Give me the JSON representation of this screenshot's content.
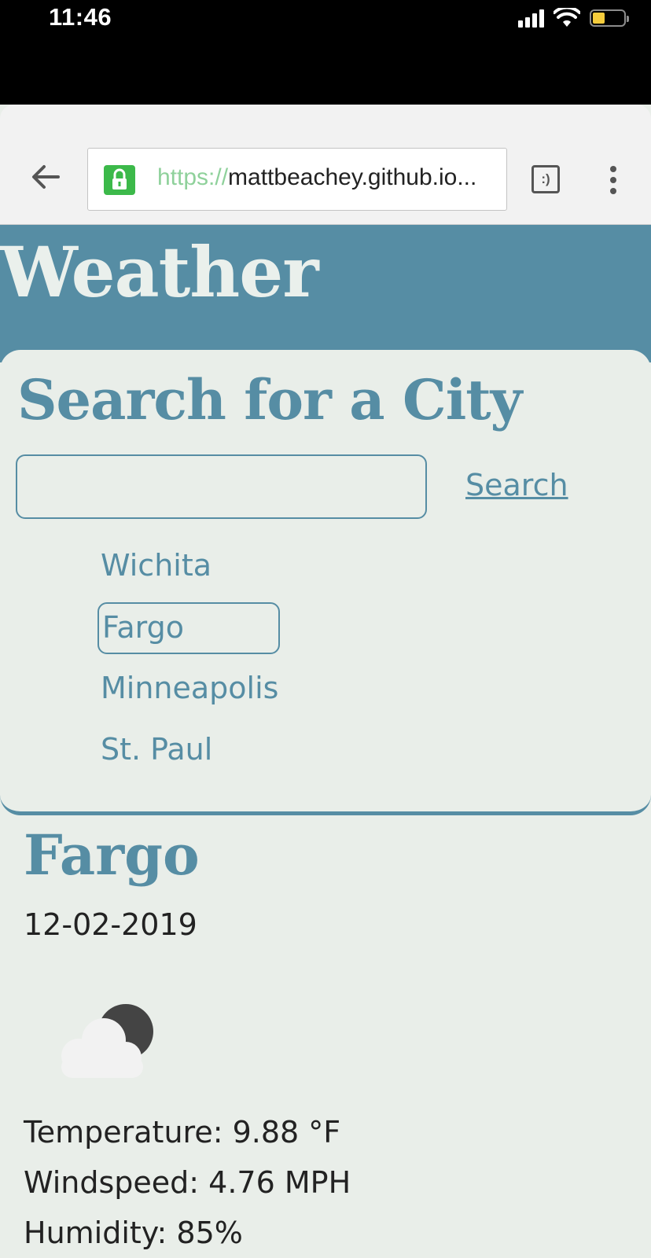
{
  "status_bar": {
    "time": "11:46",
    "battery_color": "#f5cc3c"
  },
  "browser": {
    "url_scheme": "https://",
    "url_host": "mattbeachey.github.io...",
    "tabs_label": ":)"
  },
  "page": {
    "header_title": "Weather",
    "search": {
      "title": "Search for a City",
      "input_value": "",
      "input_placeholder": "",
      "button_label": "Search"
    },
    "cities": [
      {
        "label": "Wichita"
      },
      {
        "label": "Fargo"
      },
      {
        "label": "Minneapolis"
      },
      {
        "label": "St. Paul"
      }
    ],
    "selected_city": "Fargo",
    "result": {
      "city": "Fargo",
      "date": "12-02-2019",
      "icon": "partly-cloudy-night-icon",
      "temperature": "Temperature: 9.88 °F",
      "windspeed": "Windspeed: 4.76 MPH",
      "humidity": "Humidity: 85%"
    }
  },
  "colors": {
    "accent": "#568da4",
    "background": "#e9eee9",
    "header_text": "#eaf0ec",
    "lock_green": "#3cb94a"
  }
}
